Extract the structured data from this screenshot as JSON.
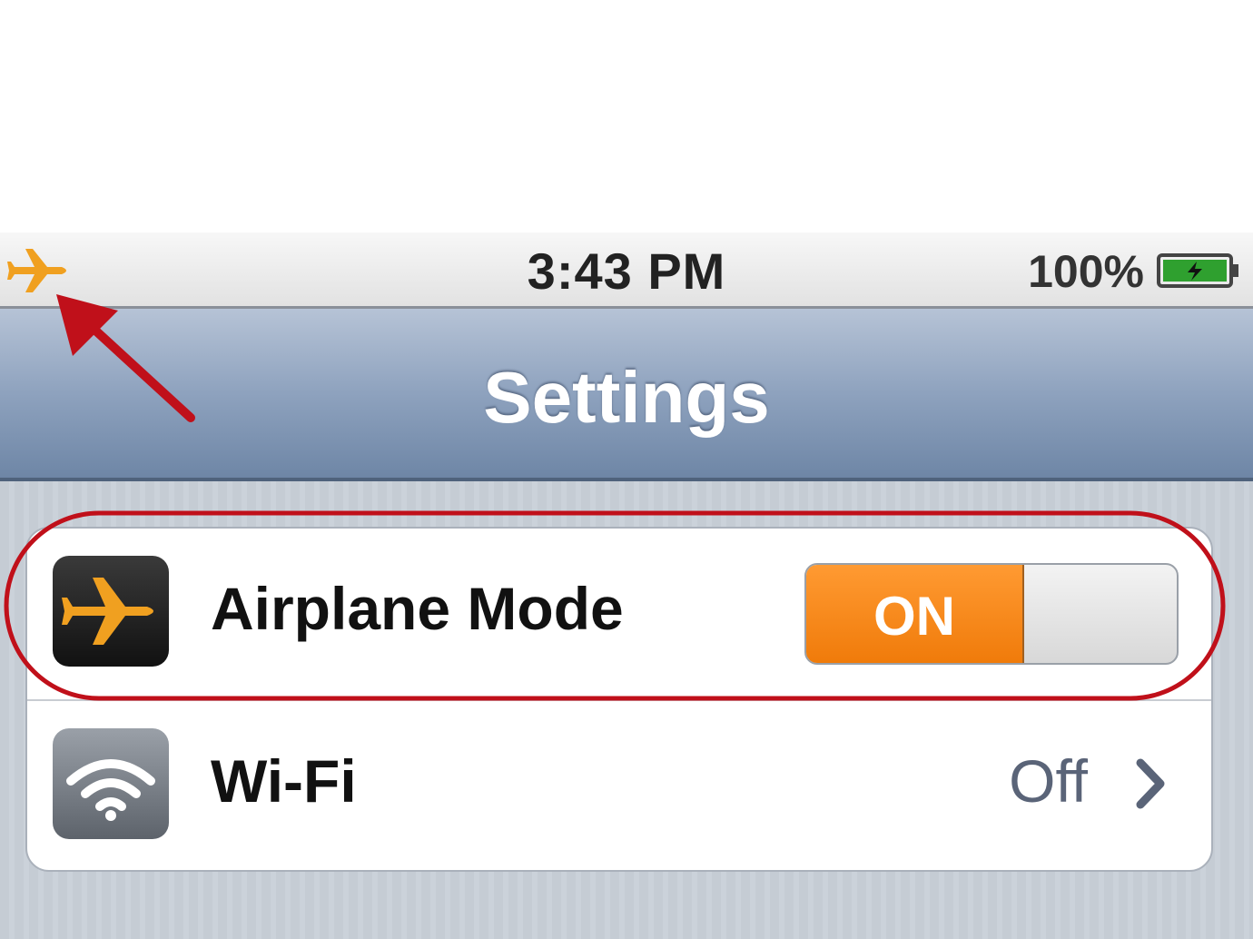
{
  "status_bar": {
    "time": "3:43 PM",
    "battery_percent": "100%",
    "icons": [
      "airplane-icon",
      "battery-icon"
    ]
  },
  "nav_bar": {
    "title": "Settings"
  },
  "settings": {
    "rows": [
      {
        "label": "Airplane Mode",
        "icon": "airplane-icon",
        "control": "toggle",
        "toggle_label": "ON",
        "on": true
      },
      {
        "label": "Wi-Fi",
        "icon": "wifi-icon",
        "value": "Off",
        "accessory": "chevron-right-icon"
      }
    ]
  },
  "colors": {
    "toggle_on": "#f07b0a",
    "nav_bar": "#8ea2be",
    "annotation": "#c0101a"
  }
}
